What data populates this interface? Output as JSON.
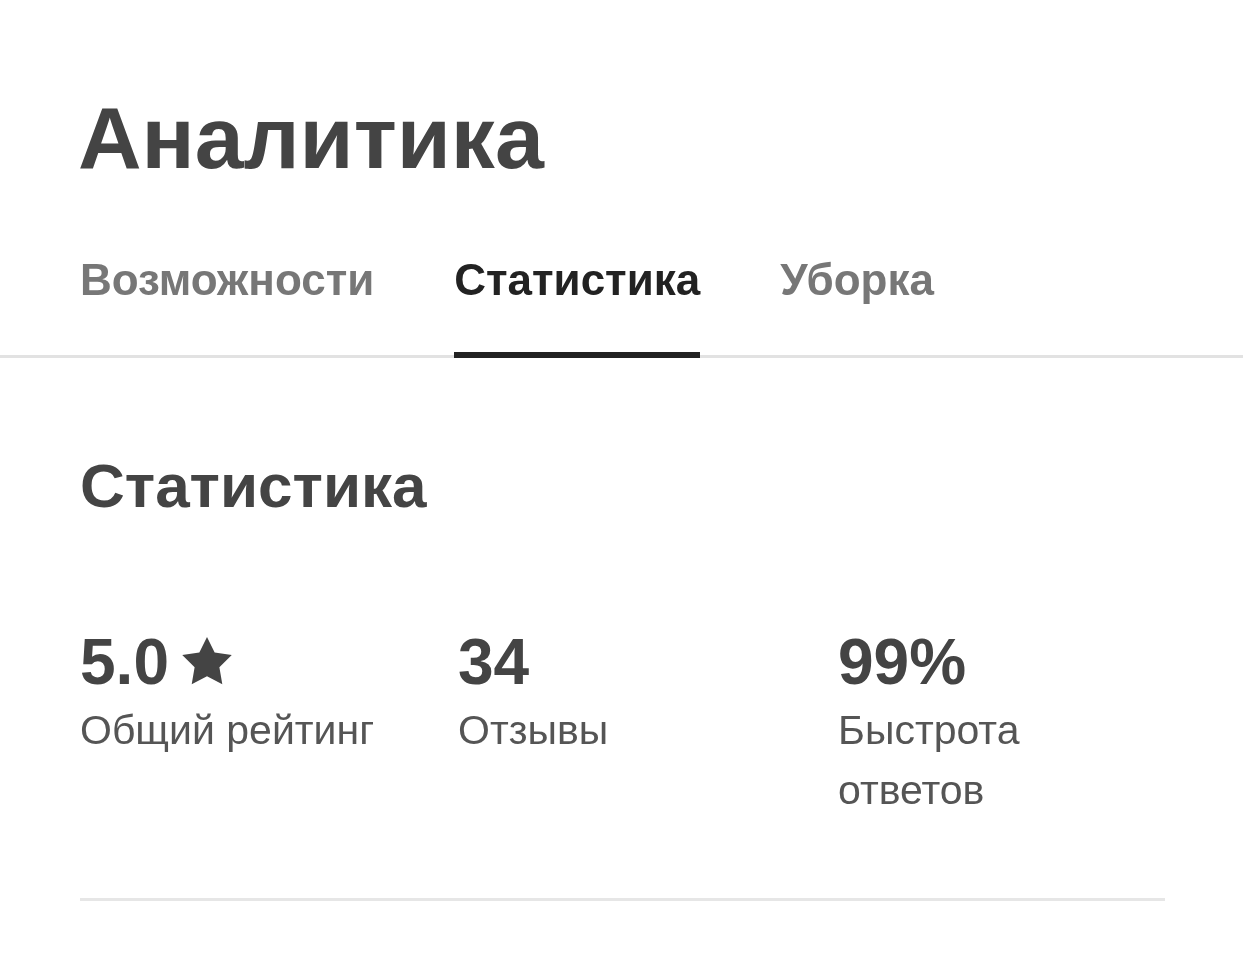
{
  "page_title": "Аналитика",
  "tabs": [
    {
      "label": "Возможности",
      "selected": false
    },
    {
      "label": "Статистика",
      "selected": true
    },
    {
      "label": "Уборка",
      "selected": false
    }
  ],
  "section_title": "Статистика",
  "stats": [
    {
      "kind": "rating",
      "value": "5.0",
      "label": "Общий рейтинг"
    },
    {
      "kind": "plain",
      "value": "34",
      "label": "Отзывы"
    },
    {
      "kind": "plain",
      "value": "99%",
      "label": "Быстрота ответов"
    }
  ]
}
